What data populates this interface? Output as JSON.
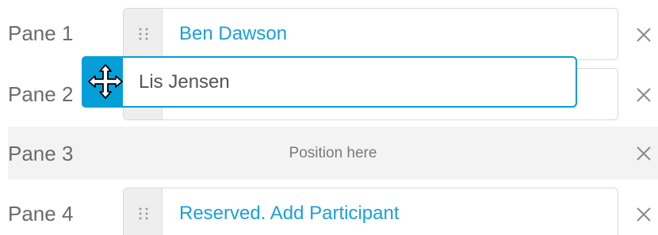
{
  "panes": [
    {
      "label": "Pane 1",
      "participant": "Ben Dawson"
    },
    {
      "label": "Pane 2",
      "participant": ""
    },
    {
      "label": "Pane 3",
      "drop_hint": "Position here"
    },
    {
      "label": "Pane 4",
      "participant": "Reserved. Add Participant"
    }
  ],
  "drag": {
    "participant": "Lis Jensen",
    "cursor_icon": "move-cursor-icon"
  },
  "icons": {
    "handle": "drag-handle-icon",
    "remove": "close-icon"
  },
  "colors": {
    "accent": "#049fd9",
    "link_text": "#1a9fd9",
    "label_text": "#6b6b6b",
    "drop_zone_bg": "#f3f3f3",
    "handle_bg": "#eeeeee"
  }
}
